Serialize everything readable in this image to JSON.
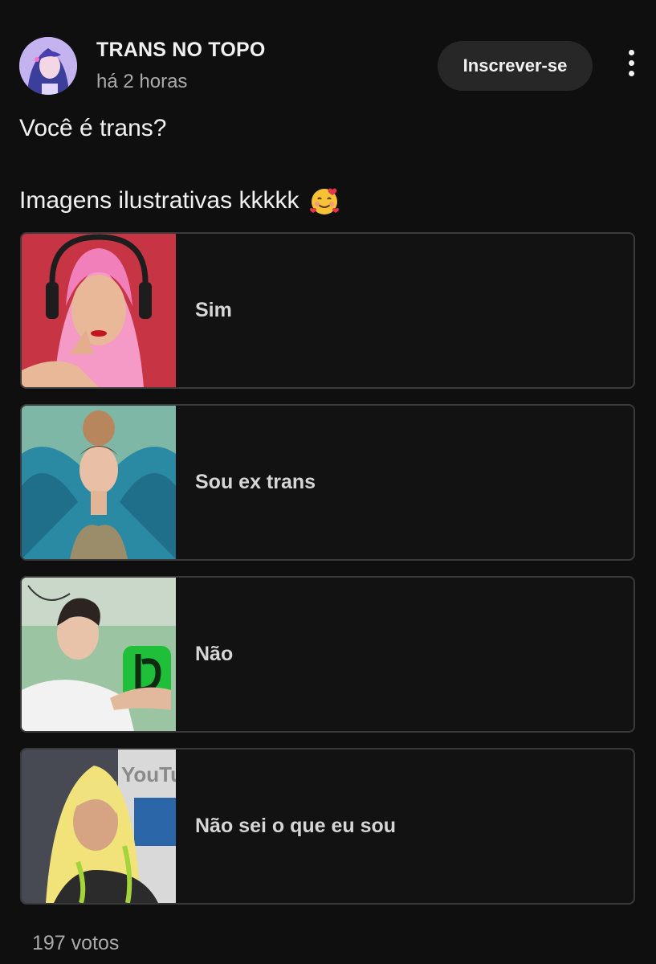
{
  "post": {
    "channel_name": "TRANS NO TOPO",
    "time": "há 2 horas",
    "subscribe_label": "Inscrever-se",
    "question": "Você é trans?",
    "subtitle": "Imagens ilustrativas kkkkk",
    "emoji": "smiling-face-with-hearts"
  },
  "poll": {
    "options": [
      {
        "label": "Sim"
      },
      {
        "label": "Sou ex trans"
      },
      {
        "label": "Não"
      },
      {
        "label": "Não sei o que eu sou"
      }
    ],
    "votes": "197 votos"
  },
  "colors": {
    "background": "#0f0f0f",
    "option_border": "#3a3a3a",
    "button_bg": "#272727",
    "secondary_text": "#aaaaaa"
  }
}
